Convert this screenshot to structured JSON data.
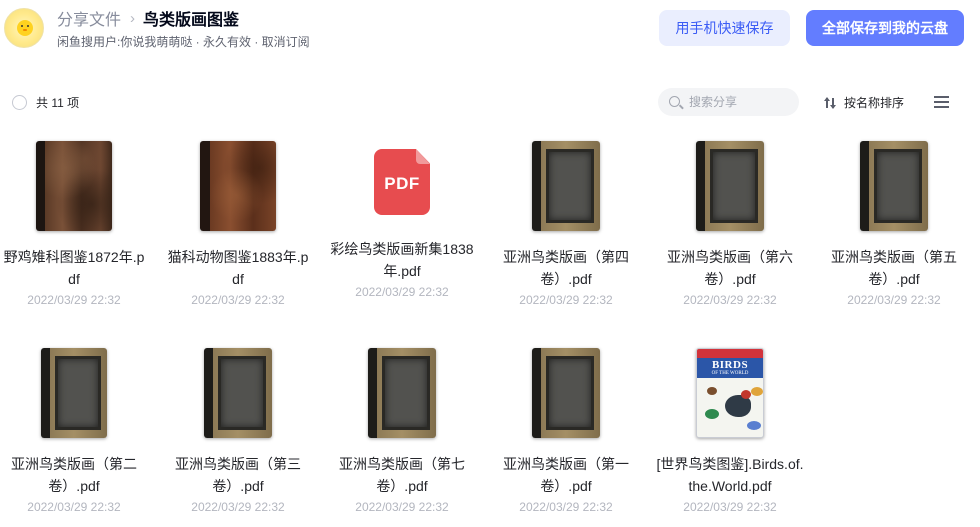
{
  "header": {
    "breadcrumb_root": "分享文件",
    "breadcrumb_separator": "›",
    "breadcrumb_current": "鸟类版画图鉴",
    "subline": "闲鱼搜用户:你说我萌萌哒 · 永久有效 · 取消订阅",
    "btn_phone": "用手机快速保存",
    "btn_save": "全部保存到我的云盘"
  },
  "toolbar": {
    "count": "共 11 项",
    "search_placeholder": "搜索分享",
    "sort_label": "按名称排序"
  },
  "files": [
    {
      "name": "野鸡雉科图鉴1872年.pdf",
      "date": "2022/03/29 22:32",
      "icon": "book-cover-icon"
    },
    {
      "name": "猫科动物图鉴1883年.pdf",
      "date": "2022/03/29 22:32",
      "icon": "book-cover-icon"
    },
    {
      "name": "彩绘鸟类版画新集1838年.pdf",
      "date": "2022/03/29 22:32",
      "icon": "pdf-icon",
      "pdf_label": "PDF"
    },
    {
      "name": "亚洲鸟类版画（第四卷）.pdf",
      "date": "2022/03/29 22:32",
      "icon": "book-cover-icon"
    },
    {
      "name": "亚洲鸟类版画（第六卷）.pdf",
      "date": "2022/03/29 22:32",
      "icon": "book-cover-icon"
    },
    {
      "name": "亚洲鸟类版画（第五卷）.pdf",
      "date": "2022/03/29 22:32",
      "icon": "book-cover-icon"
    },
    {
      "name": "亚洲鸟类版画（第二卷）.pdf",
      "date": "2022/03/29 22:32",
      "icon": "book-cover-icon"
    },
    {
      "name": "亚洲鸟类版画（第三卷）.pdf",
      "date": "2022/03/29 22:32",
      "icon": "book-cover-icon"
    },
    {
      "name": "亚洲鸟类版画（第七卷）.pdf",
      "date": "2022/03/29 22:32",
      "icon": "book-cover-icon"
    },
    {
      "name": "亚洲鸟类版画（第一卷）.pdf",
      "date": "2022/03/29 22:32",
      "icon": "book-cover-icon"
    },
    {
      "name": "[世界鸟类图鉴].Birds.of.the.World.pdf",
      "date": "2022/03/29 22:32",
      "icon": "book-cover-icon",
      "cover_title": "BIRDS",
      "cover_subtitle": "OF THE WORLD"
    }
  ],
  "colors": {
    "primary": "#637dff",
    "primary_light": "#eaeefe",
    "text": "#25262b",
    "muted": "#b3b6bf",
    "pdf_red": "#e74c4f"
  }
}
